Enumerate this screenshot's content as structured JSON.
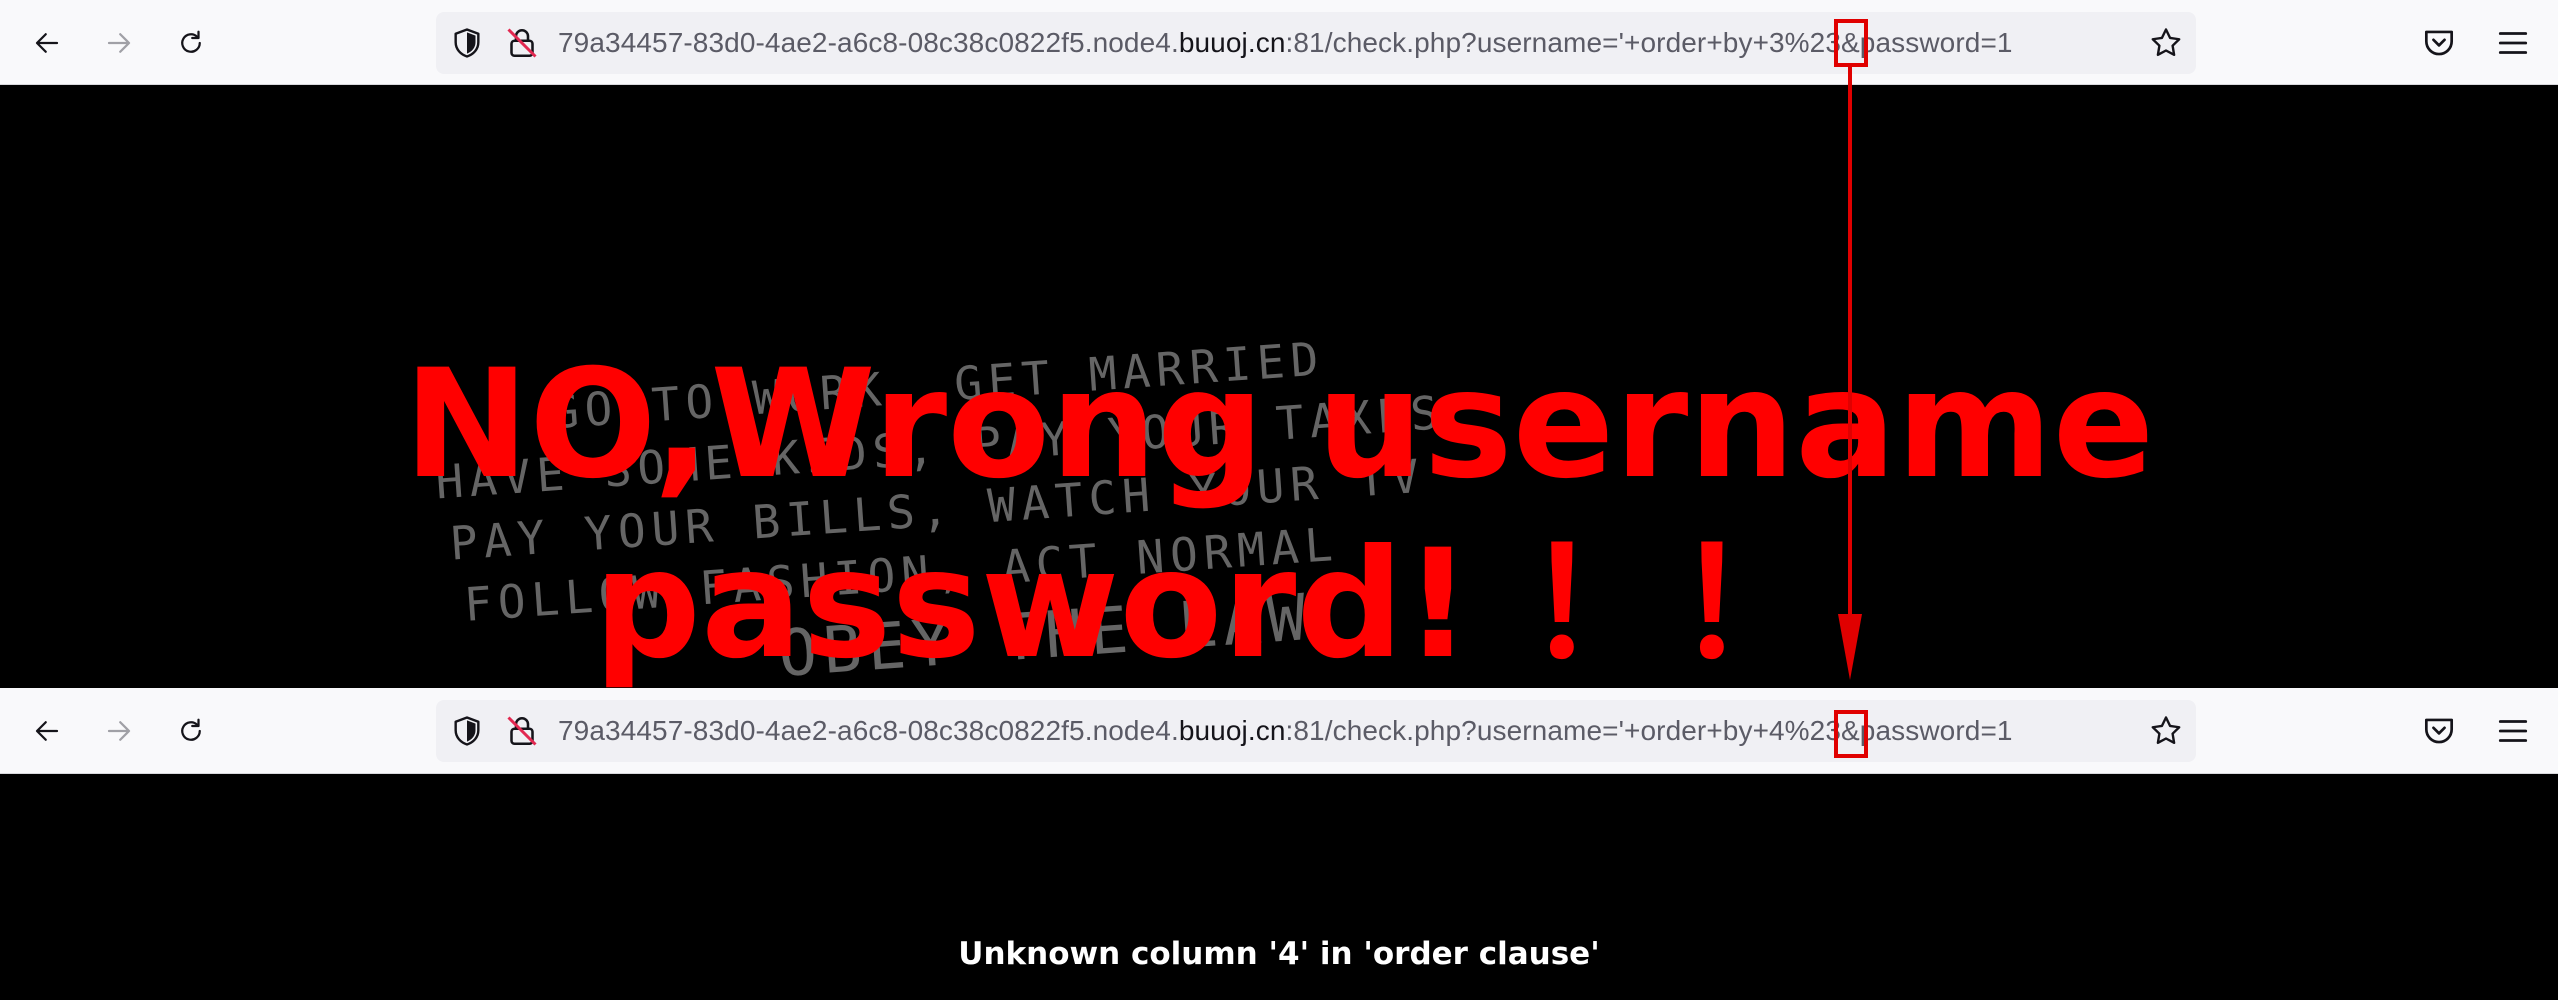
{
  "top_browser": {
    "url_prefix": "79a34457-83d0-4ae2-a6c8-08c38c0822f5.node4.",
    "url_host": "buuoj.cn",
    "url_suffix": ":81/check.php?username='+order+by+3%23&password=1"
  },
  "bottom_browser": {
    "url_prefix": "79a34457-83d0-4ae2-a6c8-08c38c0822f5.node4.",
    "url_host": "buuoj.cn",
    "url_suffix": ":81/check.php?username='+order+by+4%23&password=1"
  },
  "page_top": {
    "headline_line1": "NO,Wrong username",
    "headline_line2": "password! ！！",
    "background_text": [
      "GO TO WORK, GET MARRIED",
      "HAVE SOME KIDS, PAY YOUR TAXES",
      "PAY YOUR BILLS, WATCH YOUR TV",
      "FOLLOW FASHION, ACT NORMAL",
      "OBEY THE LAW"
    ]
  },
  "page_bottom": {
    "error_message": "Unknown column '4' in 'order clause'"
  },
  "icons": {
    "back": "back-arrow-icon",
    "forward": "forward-arrow-icon",
    "reload": "reload-icon",
    "tracking": "shield-icon",
    "insecure": "insecure-lock-icon",
    "bookmark": "star-icon",
    "pocket": "pocket-icon",
    "menu": "hamburger-menu-icon"
  },
  "colors": {
    "annotation": "#e00000",
    "headline": "#ff0000",
    "toolbar": "#f9f9fb",
    "urlbar": "#f0f0f4"
  }
}
